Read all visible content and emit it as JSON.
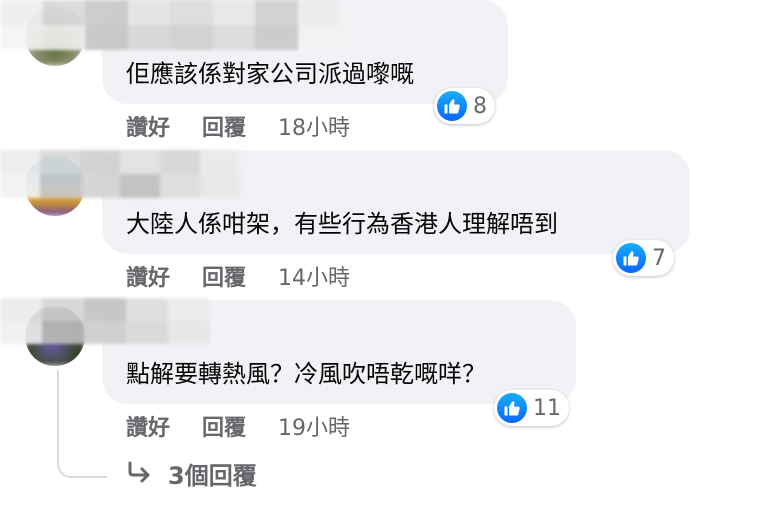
{
  "comments": [
    {
      "text": "佢應該係對家公司派過嚟嘅",
      "reactions": "8",
      "like_label": "讚好",
      "reply_label": "回覆",
      "time": "18小時"
    },
    {
      "text": "大陸人係咁架，有些行為香港人理解唔到",
      "reactions": "7",
      "like_label": "讚好",
      "reply_label": "回覆",
      "time": "14小時"
    },
    {
      "text": "點解要轉熱風？冷風吹唔乾嘅咩？",
      "reactions": "11",
      "like_label": "讚好",
      "reply_label": "回覆",
      "time": "19小時"
    }
  ],
  "replies_link": {
    "label": "3個回覆",
    "icon": "reply-arrow-icon"
  },
  "colors": {
    "bubble": "#f0f2f5",
    "like_blue": "#0866ff",
    "meta_gray": "#65676b",
    "text": "#050505"
  }
}
